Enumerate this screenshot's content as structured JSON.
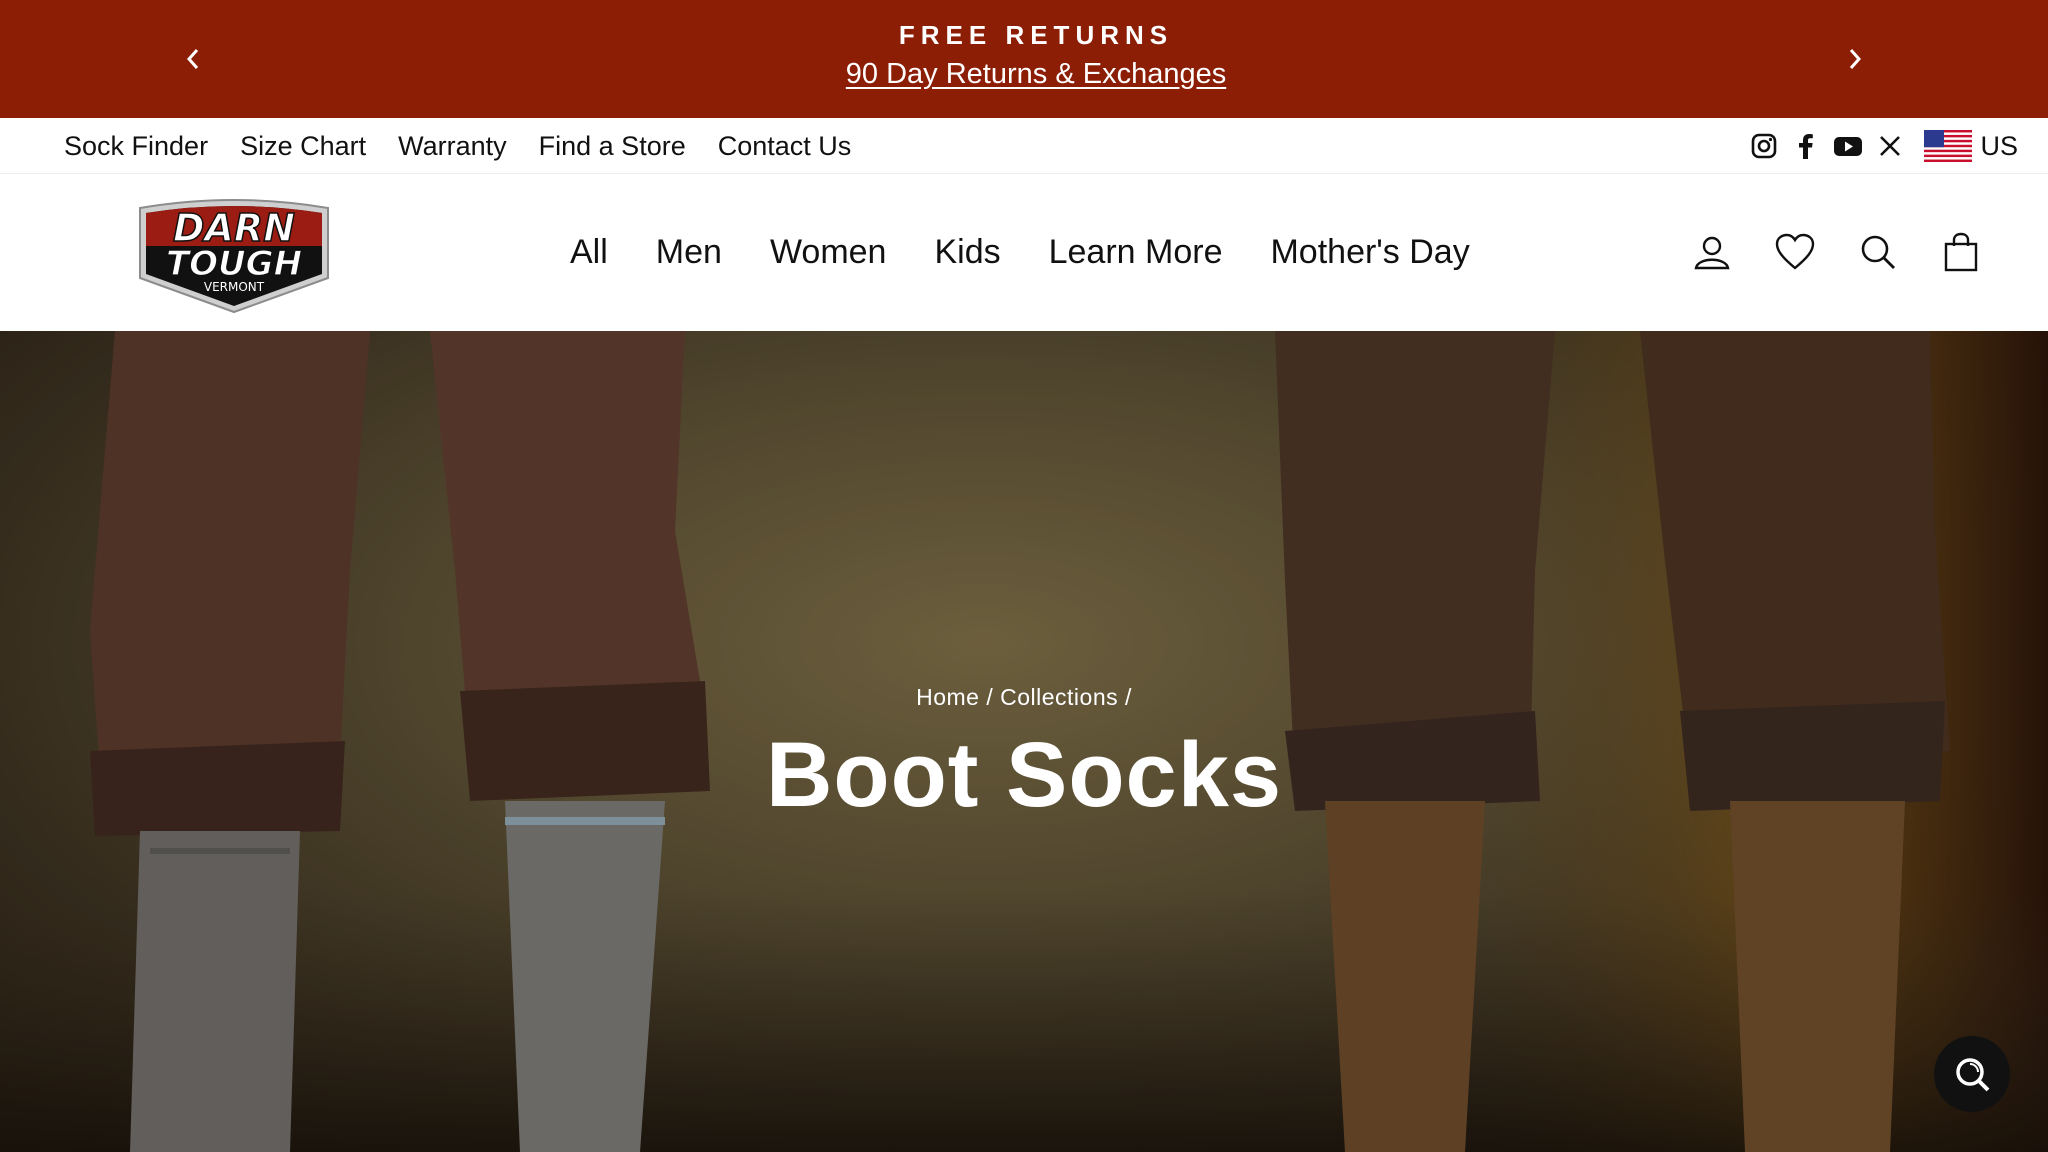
{
  "announcement": {
    "title": "FREE RETURNS",
    "subtitle": "90 Day Returns & Exchanges",
    "background": "#8b1e05"
  },
  "utility": {
    "links": [
      "Sock Finder",
      "Size Chart",
      "Warranty",
      "Find a Store",
      "Contact Us"
    ],
    "social_icons": [
      "instagram-icon",
      "facebook-icon",
      "youtube-icon",
      "x-icon"
    ],
    "region": "US"
  },
  "header": {
    "logo_text": [
      "DARN",
      "TOUGH",
      "VERMONT"
    ],
    "nav": [
      "All",
      "Men",
      "Women",
      "Kids",
      "Learn More",
      "Mother's Day"
    ],
    "icons": [
      "account-icon",
      "wishlist-heart-icon",
      "search-icon",
      "cart-bag-icon"
    ]
  },
  "hero": {
    "breadcrumb": [
      "Home",
      "Collections"
    ],
    "title": "Boot Socks"
  }
}
